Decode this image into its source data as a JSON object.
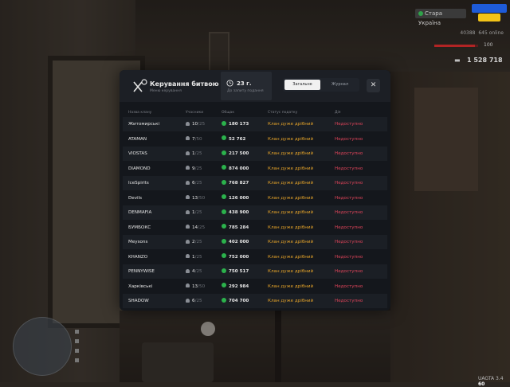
{
  "hud": {
    "server_name": "Стара Україна",
    "stat_1": "40388",
    "stat_2": "645 online",
    "hp_value": "100",
    "hp_fraction": 0.92,
    "money": "1 528 718",
    "version": "UAGTA 3.4",
    "fps": "60"
  },
  "modal": {
    "title": "Керування битвою",
    "subtitle": "Меню керування",
    "timer": {
      "value": "23 г.",
      "label": "До запиту подання"
    },
    "tabs": [
      {
        "label": "Загальне",
        "active": true
      },
      {
        "label": "Журнал",
        "active": false
      }
    ],
    "close_label": "✕",
    "columns": {
      "name": "Назва клану",
      "members": "Учасники",
      "total": "Общак",
      "status": "Статус податку",
      "action": "Дія"
    },
    "rows": [
      {
        "name": "Житомирські",
        "members": "10",
        "max": "/25",
        "total": "180 173",
        "status": "Клан дуже дрібний",
        "action": "Недоступно"
      },
      {
        "name": "ATAMAN",
        "members": "7",
        "max": "/50",
        "total": "52 762",
        "status": "Клан дуже дрібний",
        "action": "Недоступно"
      },
      {
        "name": "VIOSTAS",
        "members": "1",
        "max": "/25",
        "total": "217 500",
        "status": "Клан дуже дрібний",
        "action": "Недоступно"
      },
      {
        "name": "DIAMOND",
        "members": "9",
        "max": "/25",
        "total": "874 000",
        "status": "Клан дуже дрібний",
        "action": "Недоступно"
      },
      {
        "name": "IceSpirits",
        "members": "6",
        "max": "/25",
        "total": "768 827",
        "status": "Клан дуже дрібний",
        "action": "Недоступно"
      },
      {
        "name": "Devils",
        "members": "13",
        "max": "/50",
        "total": "126 000",
        "status": "Клан дуже дрібний",
        "action": "Недоступно"
      },
      {
        "name": "DENMAFIA",
        "members": "1",
        "max": "/25",
        "total": "438 900",
        "status": "Клан дуже дрібний",
        "action": "Недоступно"
      },
      {
        "name": "БУМБОКС",
        "members": "14",
        "max": "/25",
        "total": "785 284",
        "status": "Клан дуже дрібний",
        "action": "Недоступно"
      },
      {
        "name": "Meysons",
        "members": "2",
        "max": "/25",
        "total": "402 000",
        "status": "Клан дуже дрібний",
        "action": "Недоступно"
      },
      {
        "name": "KHANZO",
        "members": "1",
        "max": "/25",
        "total": "752 000",
        "status": "Клан дуже дрібний",
        "action": "Недоступно"
      },
      {
        "name": "PENNYWISE",
        "members": "4",
        "max": "/25",
        "total": "750 517",
        "status": "Клан дуже дрібний",
        "action": "Недоступно"
      },
      {
        "name": "Харківські",
        "members": "13",
        "max": "/50",
        "total": "292 984",
        "status": "Клан дуже дрібний",
        "action": "Недоступно"
      },
      {
        "name": "SHADOW",
        "members": "6",
        "max": "/25",
        "total": "704 700",
        "status": "Клан дуже дрібний",
        "action": "Недоступно"
      }
    ]
  }
}
